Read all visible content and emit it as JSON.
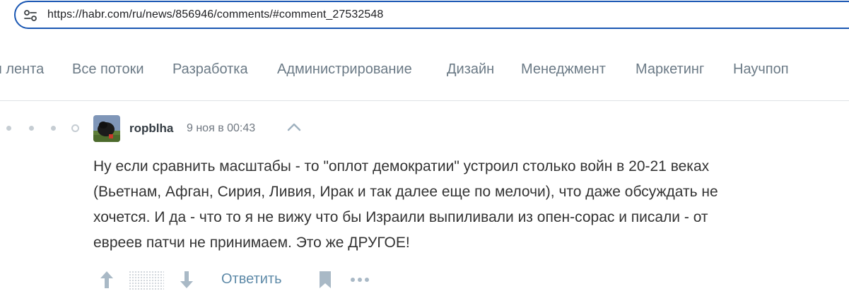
{
  "browser": {
    "url": "https://habr.com/ru/news/856946/comments/#comment_27532548",
    "site_info_icon": "tune-icon"
  },
  "nav": {
    "items": [
      {
        "label": "я лента"
      },
      {
        "label": "Все потоки"
      },
      {
        "label": "Разработка"
      },
      {
        "label": "Администрирование"
      },
      {
        "label": "Дизайн"
      },
      {
        "label": "Менеджмент"
      },
      {
        "label": "Маркетинг"
      },
      {
        "label": "Научпоп"
      }
    ]
  },
  "comment": {
    "author": "ropblha",
    "timestamp": "9 ноя в 00:43",
    "text_lines": [
      "Ну если сравнить масштабы - то \"оплот демократии\" устроил столько войн в 20-21 веках",
      "(Вьетнам, Афган, Сирия, Ливия, Ирак и так далее еще по мелочи), что даже обсуждать не",
      "хочется. И да - что то я не вижу что бы Израили выпиливали из опен-сорас и писали - от",
      "евреев патчи не принимаем. Это же ДРУГОЕ!"
    ]
  },
  "actions": {
    "reply_label": "Ответить"
  },
  "colors": {
    "accent_border": "#1a57b3",
    "link": "#5e8aa8",
    "nav_text": "#6b7a86",
    "icon": "#a9b9c6"
  }
}
